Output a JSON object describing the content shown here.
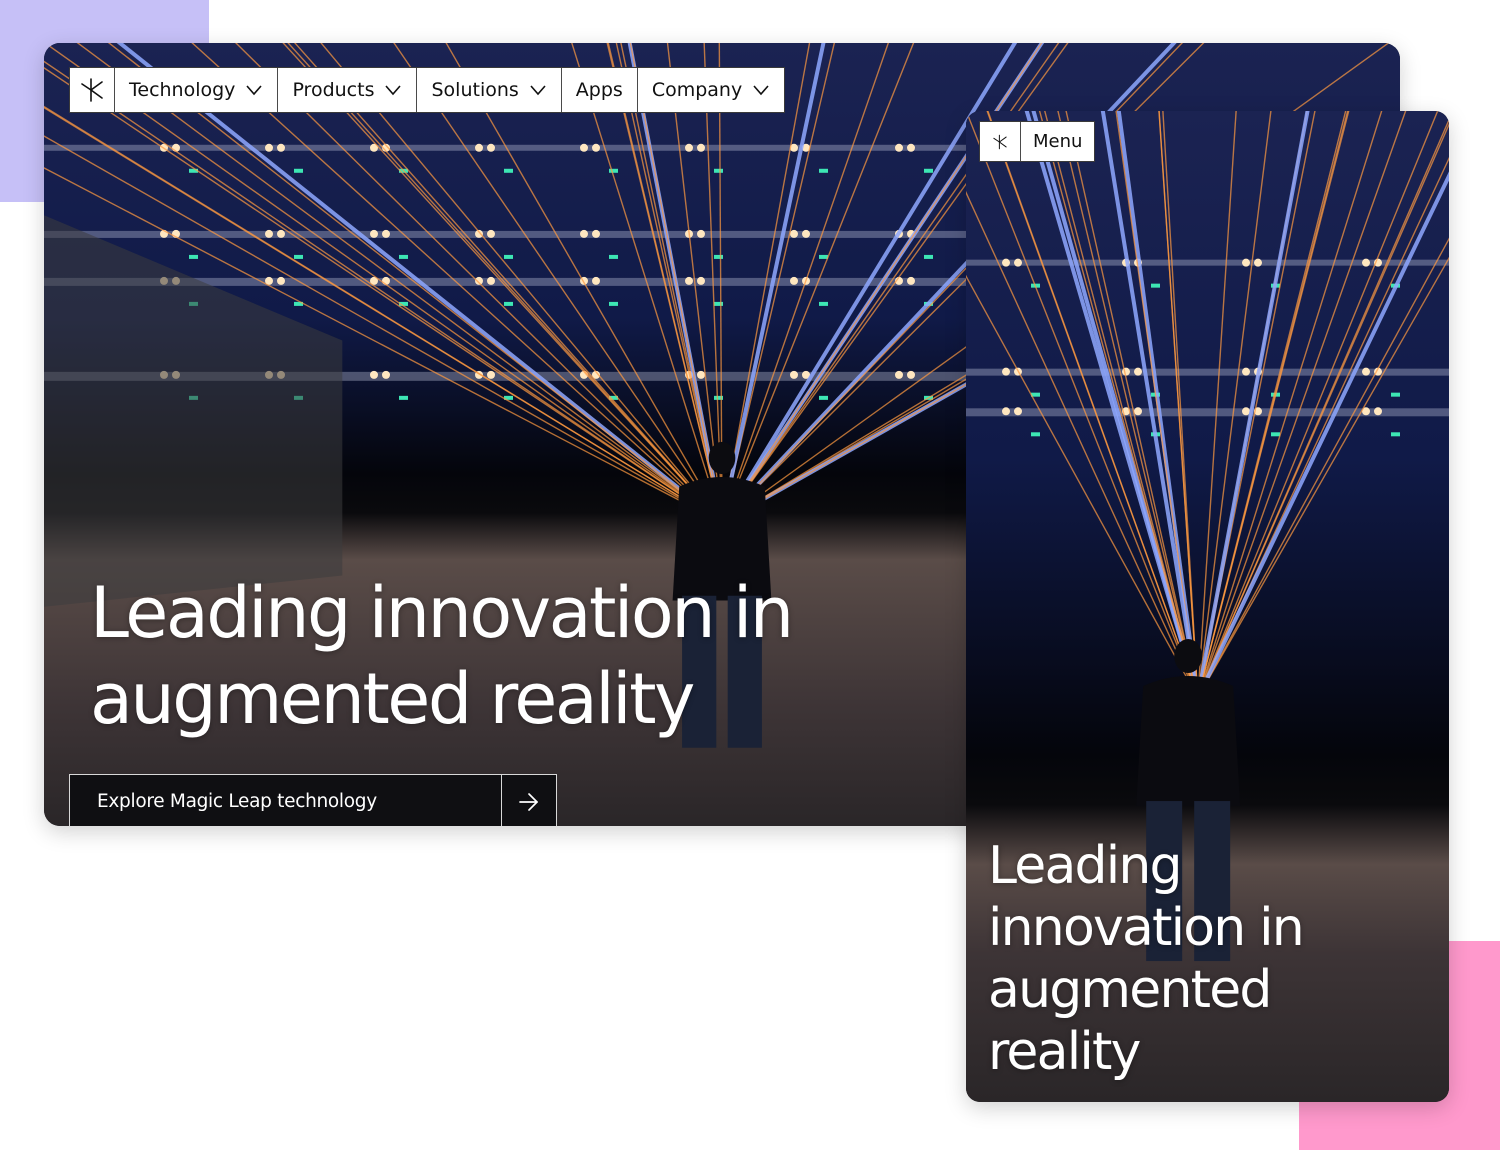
{
  "colors": {
    "accent_purple": "#c6c0f7",
    "accent_pink": "#ff99cc",
    "nav_bg": "#ffffff",
    "cta_bg": "#0f0f12",
    "headline_text": "#ffffff"
  },
  "desktop": {
    "logo_icon": "magic-leap-asterisk-icon",
    "nav": [
      {
        "label": "Technology",
        "has_dropdown": true
      },
      {
        "label": "Products",
        "has_dropdown": true
      },
      {
        "label": "Solutions",
        "has_dropdown": true
      },
      {
        "label": "Apps",
        "has_dropdown": false
      },
      {
        "label": "Company",
        "has_dropdown": true
      }
    ],
    "headline_line1": "Leading innovation in",
    "headline_line2": "augmented reality",
    "cta_label": "Explore Magic Leap technology",
    "cta_icon": "arrow-right-icon"
  },
  "mobile": {
    "logo_icon": "magic-leap-asterisk-icon",
    "menu_label": "Menu",
    "headline_lines": [
      "Leading",
      "innovation in",
      "augmented",
      "reality"
    ]
  }
}
